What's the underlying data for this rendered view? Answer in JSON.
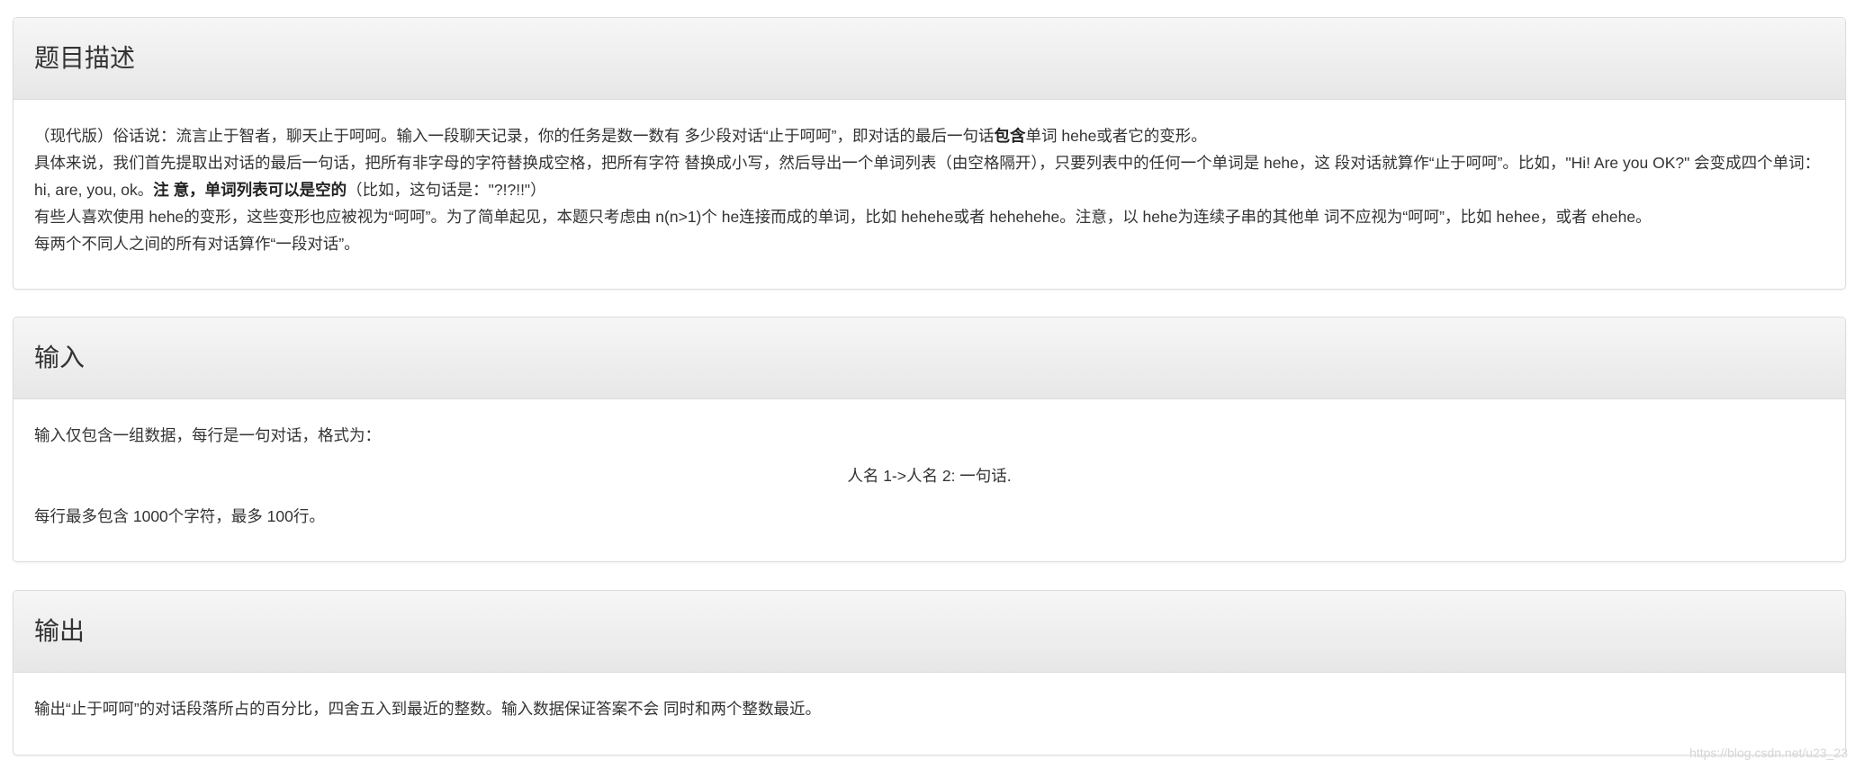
{
  "description": {
    "title": "题目描述",
    "p1": {
      "a": "（现代版）俗话说：流言止于智者，聊天止于呵呵。输入一段聊天记录，你的任务是数一数有 多少段对话“止于呵呵”，即对话的最后一句话",
      "b": "包含",
      "c": "单词 hehe或者它的变形。"
    },
    "p2": {
      "a": "具体来说，我们首先提取出对话的最后一句话，把所有非字母的字符替换成空格，把所有字符 替换成小写，然后导出一个单词列表（由空格隔开），只要列表中的任何一个单词是 hehe，这 段对话就算作“止于呵呵”。比如，\"Hi! Are you OK?\" 会变成四个单词：hi, are, you, ok。",
      "b": "注 意，单词列表可以是空的",
      "c": "（比如，这句话是：\"?!?!!\"）"
    },
    "p3": "有些人喜欢使用 hehe的变形，这些变形也应被视为“呵呵”。为了简单起见，本题只考虑由 n(n>1)个 he连接而成的单词，比如 hehehe或者 hehehehe。注意，以 hehe为连续子串的其他单 词不应视为“呵呵”，比如 hehee，或者 ehehe。",
    "p4": "每两个不同人之间的所有对话算作“一段对话”。"
  },
  "input": {
    "title": "输入",
    "p1": "输入仅包含一组数据，每行是一句对话，格式为：",
    "format": "人名 1->人名 2: 一句话.",
    "p2": "每行最多包含 1000个字符，最多 100行。"
  },
  "output": {
    "title": "输出",
    "p1": "输出“止于呵呵”的对话段落所占的百分比，四舍五入到最近的整数。输入数据保证答案不会 同时和两个整数最近。"
  },
  "watermark": "https://blog.csdn.net/u23_23"
}
